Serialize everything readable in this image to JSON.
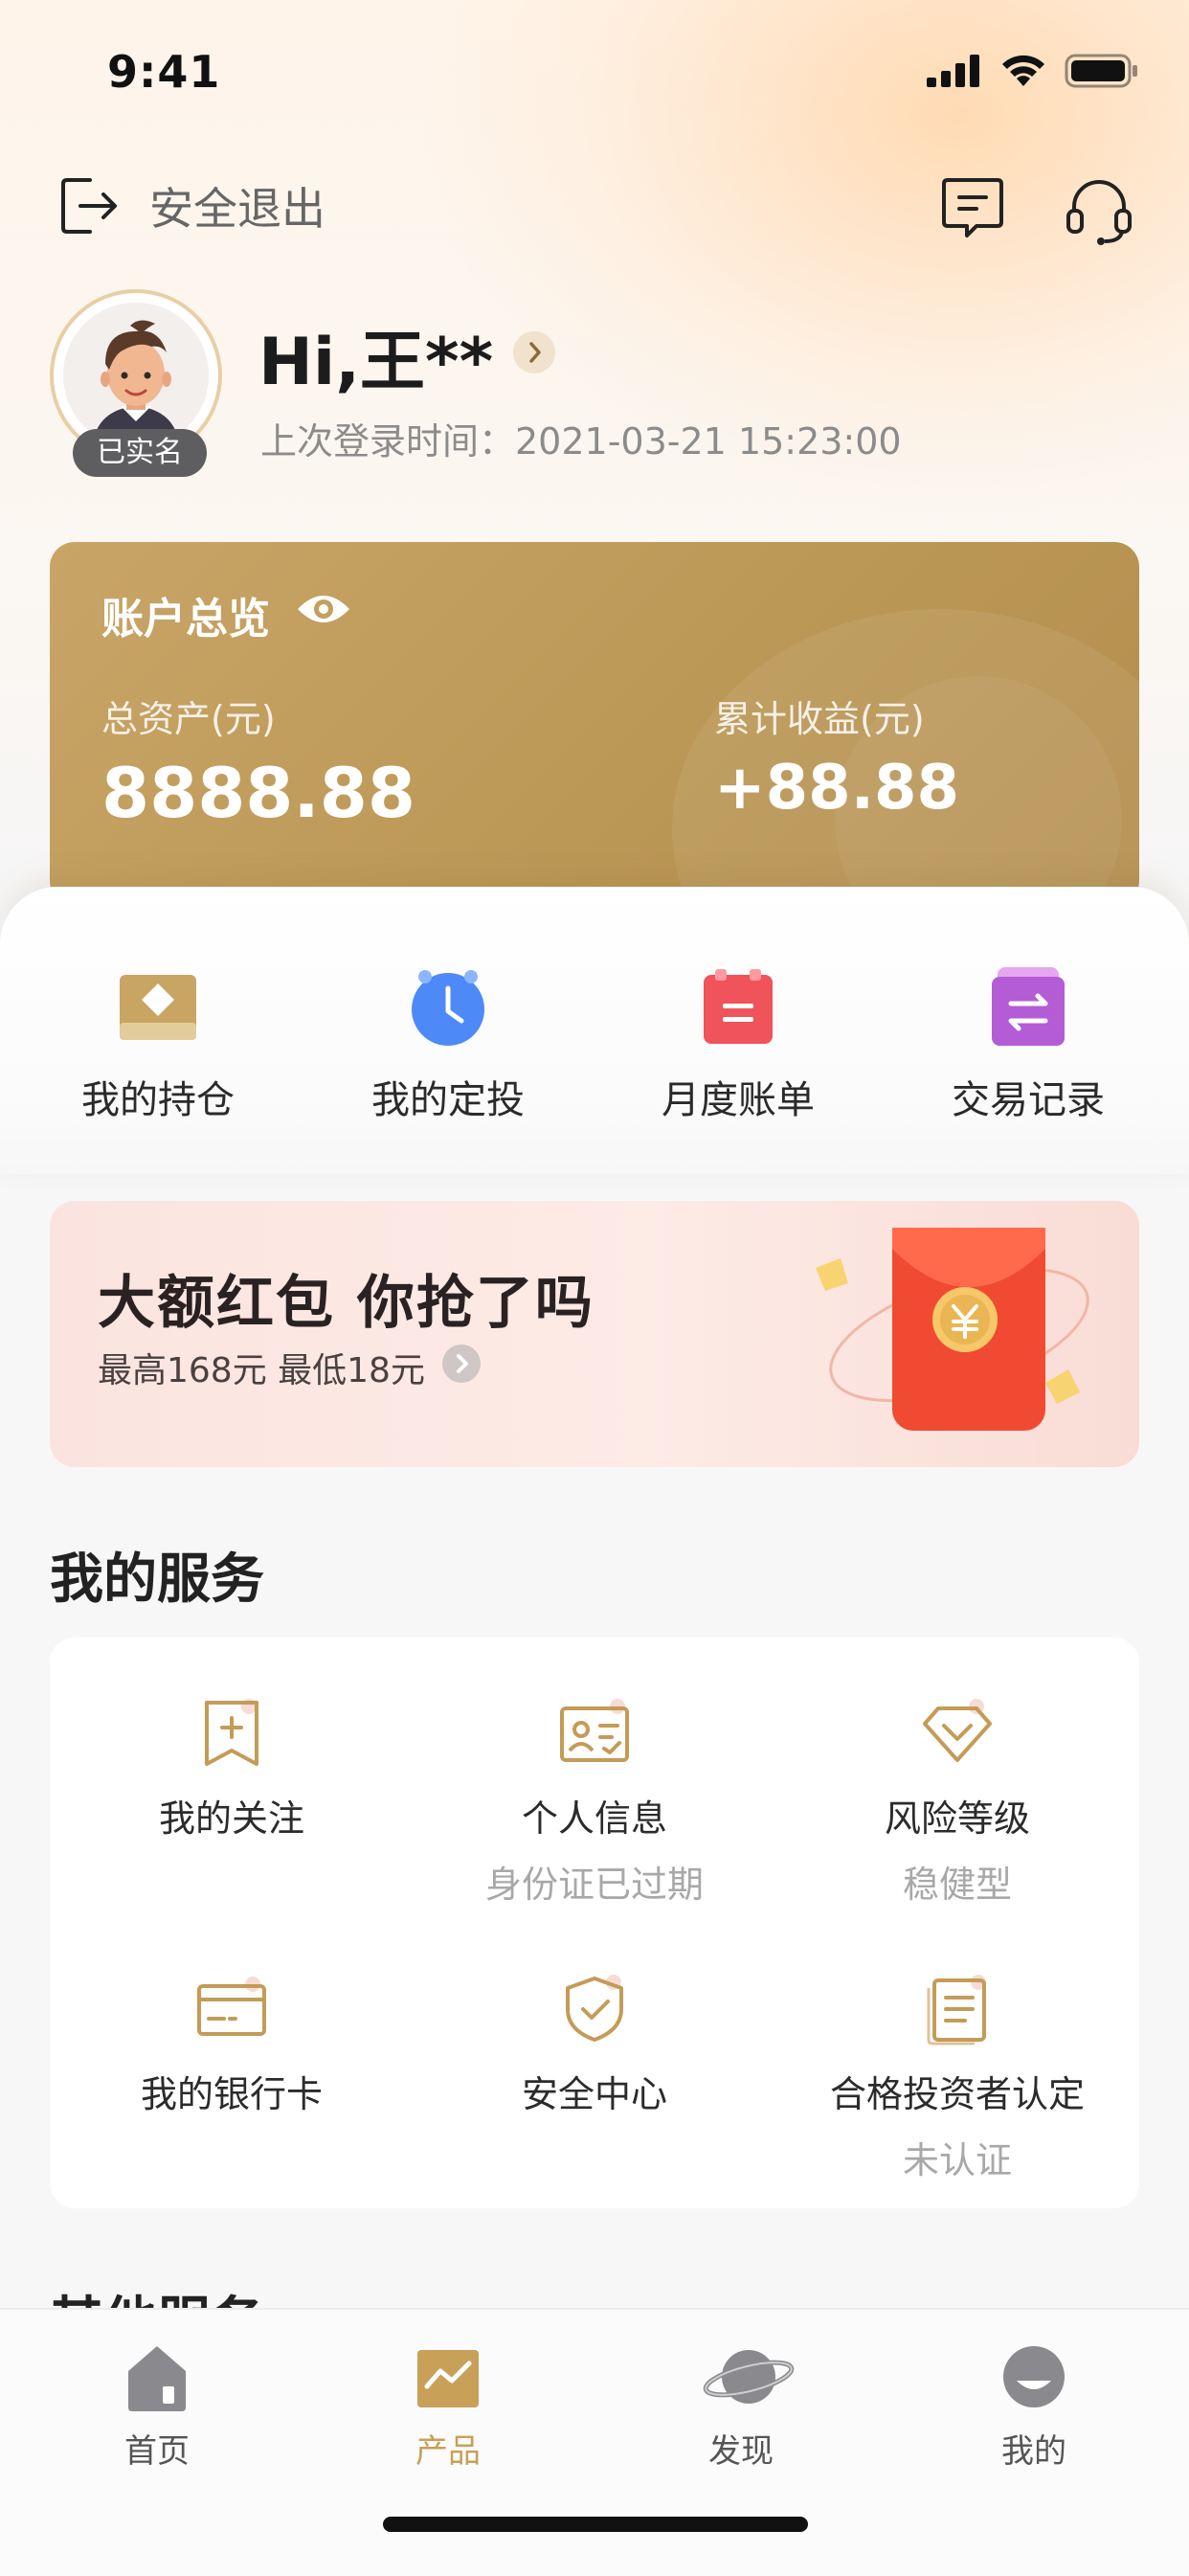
{
  "status_bar": {
    "time": "9:41"
  },
  "header": {
    "exit_label": "安全退出"
  },
  "profile": {
    "verified_label": "已实名",
    "greeting": "Hi,王**",
    "last_login": "上次登录时间：2021-03-21 15:23:00"
  },
  "account": {
    "title": "账户总览",
    "total_assets_label": "总资产(元)",
    "total_assets_value": "8888.88",
    "earnings_label": "累计收益(元)",
    "earnings_value": "+88.88"
  },
  "quick_nav": [
    {
      "label": "我的持仓",
      "icon": "holdings-icon"
    },
    {
      "label": "我的定投",
      "icon": "clock-icon"
    },
    {
      "label": "月度账单",
      "icon": "bill-icon"
    },
    {
      "label": "交易记录",
      "icon": "transfer-icon"
    }
  ],
  "banner": {
    "title": "大额红包 你抢了吗",
    "subtitle": "最高168元 最低18元"
  },
  "services": {
    "title": "我的服务",
    "items": [
      {
        "label": "我的关注",
        "sub": ""
      },
      {
        "label": "个人信息",
        "sub": "身份证已过期"
      },
      {
        "label": "风险等级",
        "sub": "稳健型"
      },
      {
        "label": "我的银行卡",
        "sub": ""
      },
      {
        "label": "安全中心",
        "sub": ""
      },
      {
        "label": "合格投资者认定",
        "sub": "未认证"
      }
    ]
  },
  "other_services": {
    "title": "其他服务"
  },
  "tabbar": {
    "items": [
      {
        "label": "首页"
      },
      {
        "label": "产品"
      },
      {
        "label": "发现"
      },
      {
        "label": "我的"
      }
    ],
    "active_index": 1
  },
  "colors": {
    "accent": "#c8a058",
    "card_gold": "#bf9b5a",
    "banner_red": "#f04b3a"
  }
}
